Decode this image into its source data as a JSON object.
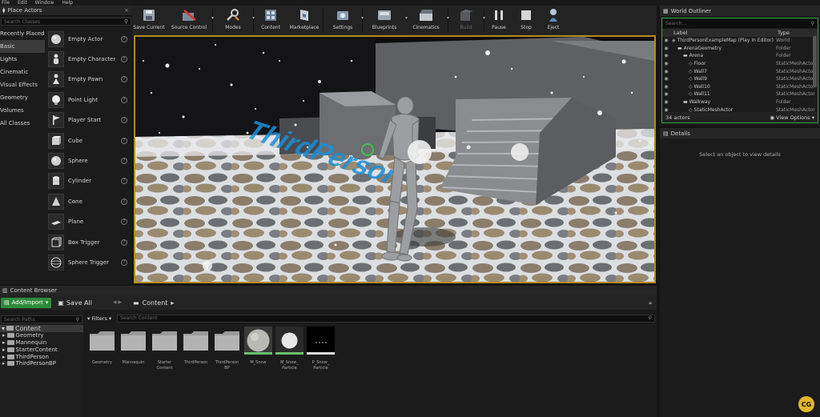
{
  "menu": [
    "File",
    "Edit",
    "Window",
    "Help"
  ],
  "place_actors": {
    "tab_title": "Place Actors",
    "search_placeholder": "Search Classes",
    "categories": [
      {
        "label": "Recently Placed",
        "active": false
      },
      {
        "label": "Basic",
        "active": true
      },
      {
        "label": "Lights",
        "active": false
      },
      {
        "label": "Cinematic",
        "active": false
      },
      {
        "label": "Visual Effects",
        "active": false
      },
      {
        "label": "Geometry",
        "active": false
      },
      {
        "label": "Volumes",
        "active": false
      },
      {
        "label": "All Classes",
        "active": false
      }
    ],
    "actors": [
      {
        "label": "Empty Actor",
        "icon": "sphere-icon"
      },
      {
        "label": "Empty Character",
        "icon": "character-icon"
      },
      {
        "label": "Empty Pawn",
        "icon": "pawn-icon"
      },
      {
        "label": "Point Light",
        "icon": "bulb-icon"
      },
      {
        "label": "Player Start",
        "icon": "flag-icon"
      },
      {
        "label": "Cube",
        "icon": "cube-icon"
      },
      {
        "label": "Sphere",
        "icon": "sphere-icon"
      },
      {
        "label": "Cylinder",
        "icon": "cylinder-icon"
      },
      {
        "label": "Cone",
        "icon": "cone-icon"
      },
      {
        "label": "Plane",
        "icon": "plane-icon"
      },
      {
        "label": "Box Trigger",
        "icon": "box-trigger-icon"
      },
      {
        "label": "Sphere Trigger",
        "icon": "sphere-trigger-icon"
      }
    ]
  },
  "toolbar": {
    "buttons": [
      {
        "label": "Save Current",
        "icon": "save-icon",
        "arrow": false,
        "disabled": false
      },
      {
        "label": "Source Control",
        "icon": "source-control-icon",
        "arrow": true,
        "disabled": false
      },
      {
        "label": "Modes",
        "icon": "modes-icon",
        "arrow": true,
        "disabled": false
      },
      {
        "label": "Content",
        "icon": "content-icon",
        "arrow": false,
        "disabled": false
      },
      {
        "label": "Marketplace",
        "icon": "marketplace-icon",
        "arrow": false,
        "disabled": false
      },
      {
        "label": "Settings",
        "icon": "settings-icon",
        "arrow": true,
        "disabled": false
      },
      {
        "label": "Blueprints",
        "icon": "blueprints-icon",
        "arrow": true,
        "disabled": false
      },
      {
        "label": "Cinematics",
        "icon": "cinematics-icon",
        "arrow": true,
        "disabled": false
      },
      {
        "label": "Build",
        "icon": "build-icon",
        "arrow": true,
        "disabled": true
      },
      {
        "label": "Pause",
        "icon": "pause-icon",
        "arrow": false,
        "disabled": false
      },
      {
        "label": "Stop",
        "icon": "stop-icon",
        "arrow": false,
        "disabled": false
      },
      {
        "label": "Eject",
        "icon": "eject-icon",
        "arrow": false,
        "disabled": false
      }
    ]
  },
  "viewport": {
    "floor_text": "ThirdPerson",
    "colors": {
      "border": "#b58a1e",
      "text": "#1b8fd6"
    }
  },
  "outliner": {
    "tab_title": "World Outliner",
    "search_placeholder": "Search...",
    "col_label": "Label",
    "col_type": "Type",
    "rows": [
      {
        "indent": 0,
        "icon": "world",
        "label": "ThirdPersonExampleMap (Play In Editor)",
        "type": "World"
      },
      {
        "indent": 1,
        "icon": "folder",
        "label": "ArenaGeometry",
        "type": "Folder"
      },
      {
        "indent": 2,
        "icon": "folder",
        "label": "Arena",
        "type": "Folder"
      },
      {
        "indent": 3,
        "icon": "mesh",
        "label": "Floor",
        "type": "StaticMeshActor"
      },
      {
        "indent": 3,
        "icon": "mesh",
        "label": "Wall7",
        "type": "StaticMeshActor"
      },
      {
        "indent": 3,
        "icon": "mesh",
        "label": "Wall9",
        "type": "StaticMeshActor"
      },
      {
        "indent": 3,
        "icon": "mesh",
        "label": "Wall10",
        "type": "StaticMeshActor"
      },
      {
        "indent": 3,
        "icon": "mesh",
        "label": "Wall11",
        "type": "StaticMeshActor"
      },
      {
        "indent": 2,
        "icon": "folder",
        "label": "Walkway",
        "type": "Folder"
      },
      {
        "indent": 3,
        "icon": "mesh",
        "label": "StaticMeshActor",
        "type": "StaticMeshActor"
      }
    ],
    "actor_count": "34 actors",
    "view_options": "View Options"
  },
  "details": {
    "tab_title": "Details",
    "empty_message": "Select an object to view details"
  },
  "content_browser": {
    "tab_title": "Content Browser",
    "add_import": "Add/Import",
    "save_all": "Save All",
    "path": "Content",
    "search_paths_placeholder": "Search Paths",
    "filters": "Filters",
    "search_content_placeholder": "Search Content",
    "tree": {
      "root": "Content",
      "children": [
        "Geometry",
        "Mannequin",
        "StarterContent",
        "ThirdPerson",
        "ThirdPersonBP"
      ]
    },
    "assets": [
      {
        "name": "Geometry",
        "kind": "folder"
      },
      {
        "name": "Mannequin",
        "kind": "folder"
      },
      {
        "name": "Starter Content",
        "kind": "folder"
      },
      {
        "name": "ThirdPerson",
        "kind": "folder"
      },
      {
        "name": "ThirdPerson BP",
        "kind": "folder"
      },
      {
        "name": "M_Snow",
        "kind": "material"
      },
      {
        "name": "M_Snow_ Particle",
        "kind": "particle-material"
      },
      {
        "name": "P_Snow_ Particle",
        "kind": "particle-system"
      }
    ]
  },
  "watermark": "CG"
}
